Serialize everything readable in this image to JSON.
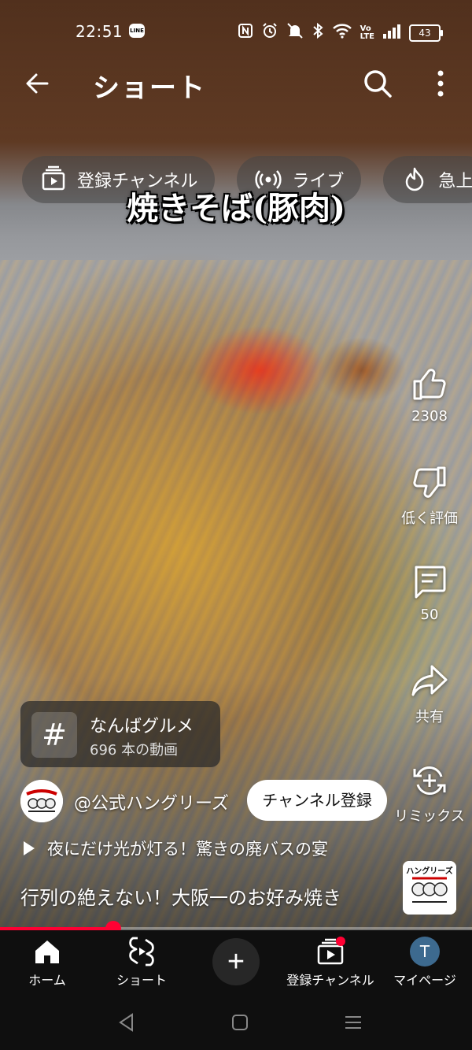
{
  "status_bar": {
    "time": "22:51",
    "line_badge": "LINE",
    "icons": [
      "nfc-icon",
      "alarm-icon",
      "mute-icon",
      "bluetooth-icon",
      "wifi-icon",
      "volte-icon",
      "signal-icon"
    ],
    "battery": "43"
  },
  "header": {
    "title": "ショート"
  },
  "chips": [
    {
      "label": "登録チャンネル",
      "icon": "subscriptions-icon"
    },
    {
      "label": "ライブ",
      "icon": "live-icon"
    },
    {
      "label": "急上",
      "icon": "trending-icon"
    }
  ],
  "video": {
    "overlay_title": "焼きそば(豚肉)",
    "progress_fraction": 0.24
  },
  "actions": {
    "like_count": "2308",
    "dislike_label": "低く評価",
    "comment_count": "50",
    "share_label": "共有",
    "remix_label": "リミックス"
  },
  "hashtag": {
    "symbol": "#",
    "name": "なんばグルメ",
    "count": "696 本の動画"
  },
  "channel": {
    "name": "@公式ハングリーズ",
    "subscribe_label": "チャンネル登録",
    "logo_text": "ハングリーズ"
  },
  "related": {
    "text": "夜にだけ光が灯る！驚きの廃バスの宴"
  },
  "caption": "行列の絶えない！大阪一のお好み焼き",
  "bottom_nav": {
    "home": "ホーム",
    "shorts": "ショート",
    "create": "+",
    "subscriptions": "登録チャンネル",
    "me": "マイページ",
    "me_initial": "T"
  },
  "colors": {
    "accent": "#ff0033",
    "nav_background": "#0f0f0f",
    "chip_background": "#464646"
  }
}
